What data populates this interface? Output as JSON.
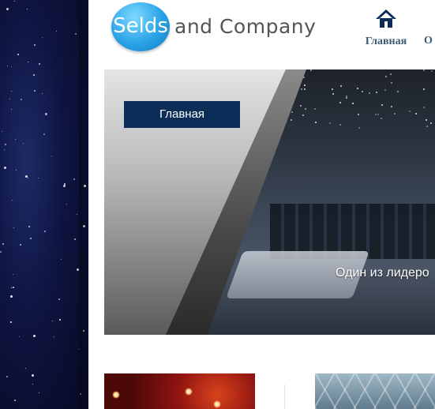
{
  "logo": {
    "circle_text": "Selds",
    "rest_text": "and Company"
  },
  "nav": {
    "home_label": "Главная",
    "next_label_partial": "О"
  },
  "banner": {
    "title": "Главная",
    "caption": "Один из лидеро"
  },
  "colors": {
    "brand_blue": "#0b2d57",
    "nav_text": "#3b5a72",
    "logo_circle": "#2aa3e6"
  },
  "icons": {
    "home": "home-icon"
  }
}
